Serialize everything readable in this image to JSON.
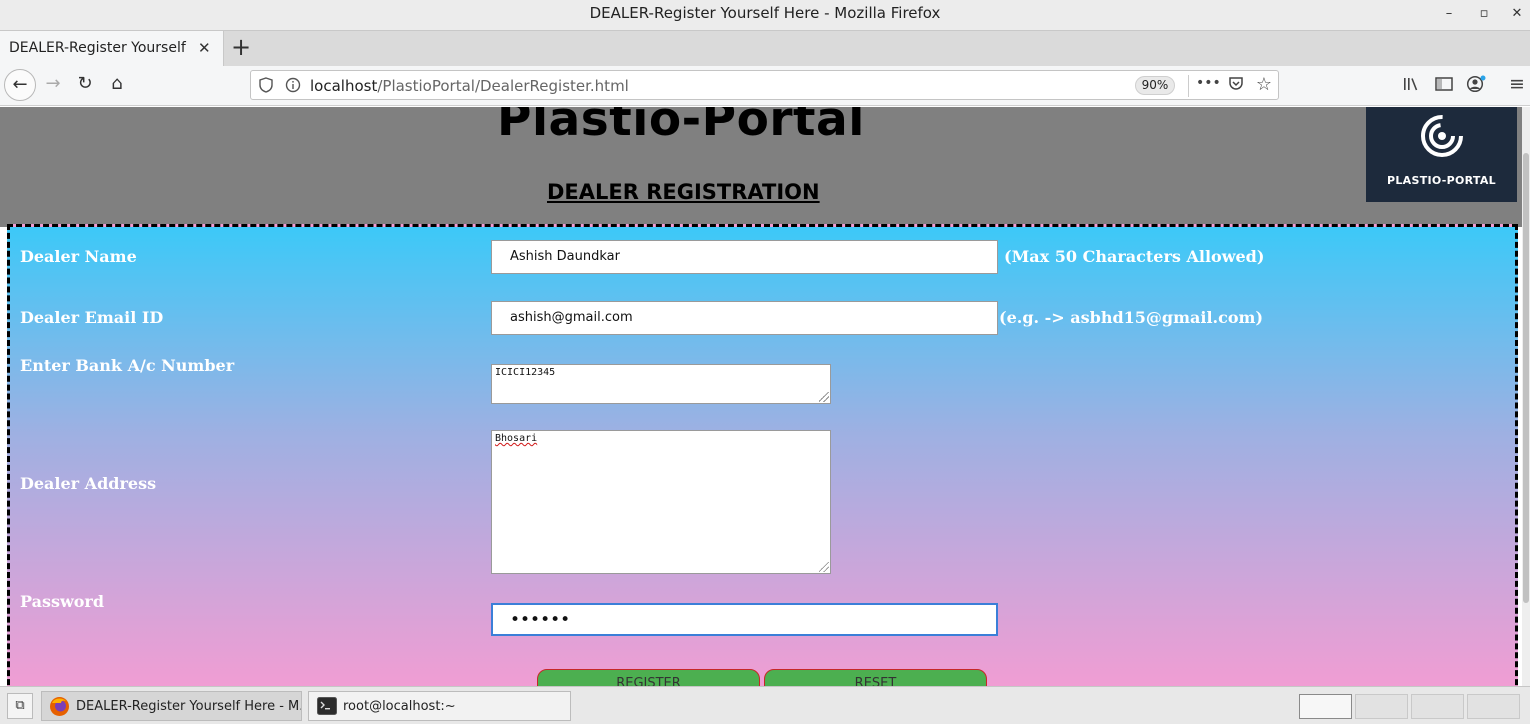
{
  "window": {
    "title": "DEALER-Register Yourself Here - Mozilla Firefox",
    "minimize_symbol": "–",
    "maximize_symbol": "▫",
    "close_symbol": "✕"
  },
  "tabs": [
    {
      "title": "DEALER-Register Yourself Here",
      "close_symbol": "✕"
    }
  ],
  "newtab_symbol": "+",
  "nav": {
    "back_symbol": "←",
    "forward_symbol": "→",
    "reload_symbol": "↻",
    "home_symbol": "⌂",
    "url_host": "localhost",
    "url_path": "/PlastioPortal/DealerRegister.html",
    "zoom": "90%",
    "more_symbol": "•••",
    "pocket_symbol": "♡",
    "star_symbol": "☆",
    "library_symbol": "|||\\",
    "sidebar_symbol": "▤",
    "account_symbol": "◉",
    "menu_symbol": "≡"
  },
  "page": {
    "site_title": "Plastio-Portal",
    "heading": "DEALER REGISTRATION",
    "logo_text": "PLASTIO-PORTAL",
    "form": {
      "dealer_name_label": "Dealer Name",
      "dealer_name_value": "Ashish Daundkar",
      "dealer_name_hint": "(Max 50 Characters Allowed)",
      "email_label": "Dealer Email ID",
      "email_value": "ashish@gmail.com",
      "email_hint": "(e.g. -> asbhd15@gmail.com)",
      "bank_label": "Enter Bank A/c Number",
      "bank_value": "ICICI12345",
      "address_label": "Dealer Address",
      "address_value": "Bhosari",
      "password_label": "Password",
      "password_mask": "••••••",
      "register_button": "REGISTER",
      "reset_button": "RESET"
    }
  },
  "taskbar": {
    "show_desktop_symbol": "⧉",
    "items": [
      {
        "label": "DEALER-Register Yourself Here - M...",
        "icon": "firefox-icon"
      },
      {
        "label": "root@localhost:~",
        "icon": "terminal-icon"
      }
    ]
  },
  "colors": {
    "page_header_bg": "#808080",
    "form_gradient_top": "#3cc9f8",
    "form_gradient_bottom": "#f29dd3",
    "button_green": "#4caf50",
    "logo_bg": "#1d2a3c"
  }
}
